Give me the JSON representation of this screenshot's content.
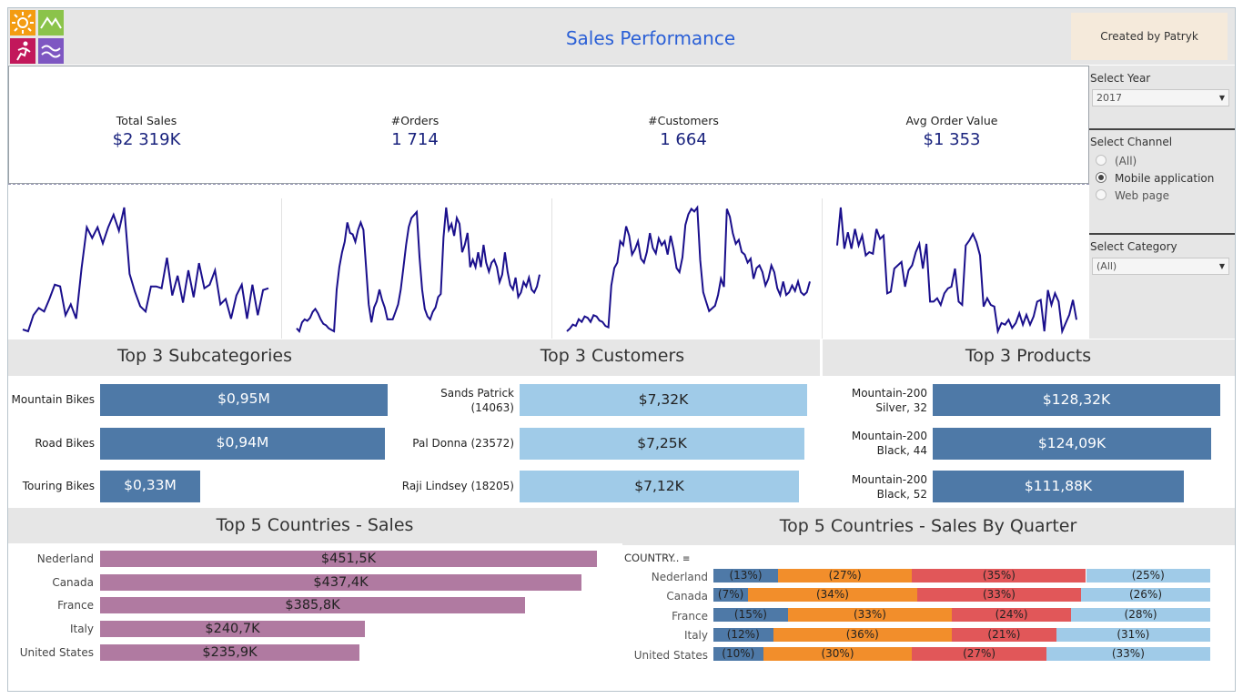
{
  "header": {
    "title": "Sales Performance",
    "created_by": "Created by Patryk Kazmierak",
    "logo_colors": [
      "#f39c12",
      "#8bc34a",
      "#c2185b",
      "#7e57c2"
    ]
  },
  "kpis": [
    {
      "label": "Total Sales",
      "value": "$2 319K"
    },
    {
      "label": "#Orders",
      "value": "1 714"
    },
    {
      "label": "#Customers",
      "value": "1 664"
    },
    {
      "label": "Avg Order Value",
      "value": "$1 353"
    }
  ],
  "filters": {
    "year": {
      "label": "Select Year",
      "value": "2017"
    },
    "channel": {
      "label": "Select Channel",
      "options": [
        "(All)",
        "Mobile application",
        "Web page"
      ],
      "selected": "Mobile application"
    },
    "category": {
      "label": "Select Category",
      "value": "(All)"
    }
  },
  "sections": {
    "subcategories": "Top 3 Subcategories",
    "customers": "Top 3 Customers",
    "products": "Top 3 Products",
    "countries_sales": "Top 5 Countries - Sales",
    "countries_quarter": "Top 5 Countries - Sales By Quarter",
    "country_column_header": "COUNTRY.."
  },
  "colors": {
    "blue": "#4e79a7",
    "lightblue": "#a0cbe8",
    "purple": "#b07aa1",
    "orange": "#f28e2b",
    "red": "#e15759",
    "line": "#1a0f8c"
  },
  "chart_data": [
    {
      "type": "line",
      "title": "Total Sales trend",
      "values": [
        2,
        1,
        10,
        14,
        12,
        19,
        27,
        26,
        10,
        16,
        8,
        36,
        59,
        53,
        59,
        50,
        59,
        66,
        57,
        70,
        33,
        23,
        15,
        12,
        26,
        26,
        25,
        42,
        21,
        32,
        17,
        35,
        20,
        39,
        25,
        27,
        35,
        16,
        19,
        8,
        21,
        27,
        8,
        27,
        10,
        24,
        25
      ]
    },
    {
      "type": "line",
      "title": "#Orders trend",
      "values": [
        4,
        2,
        8,
        10,
        9,
        11,
        15,
        17,
        14,
        10,
        7,
        6,
        4,
        3,
        2,
        30,
        45,
        55,
        62,
        75,
        68,
        67,
        62,
        70,
        75,
        70,
        45,
        20,
        8,
        18,
        22,
        30,
        23,
        18,
        10,
        10,
        10,
        15,
        20,
        30,
        45,
        60,
        72,
        78,
        80,
        82,
        52,
        30,
        17,
        12,
        10,
        15,
        18,
        25,
        27,
        65,
        85,
        70,
        74,
        66,
        78,
        74,
        55,
        60,
        68,
        45,
        50,
        45,
        55,
        45,
        60,
        48,
        42,
        48,
        50,
        45,
        35,
        40,
        55,
        42,
        33,
        30,
        38,
        25,
        28,
        35,
        32,
        38,
        30,
        28,
        32,
        40
      ]
    },
    {
      "type": "line",
      "title": "#Customers trend",
      "values": [
        1,
        3,
        6,
        5,
        10,
        8,
        12,
        11,
        8,
        13,
        12,
        9,
        8,
        5,
        4,
        35,
        48,
        52,
        68,
        65,
        79,
        72,
        58,
        62,
        68,
        55,
        52,
        60,
        74,
        63,
        59,
        70,
        65,
        68,
        58,
        72,
        62,
        48,
        45,
        56,
        80,
        88,
        92,
        90,
        93,
        54,
        30,
        23,
        16,
        18,
        20,
        28,
        40,
        34,
        92,
        86,
        74,
        66,
        69,
        60,
        58,
        52,
        55,
        40,
        48,
        50,
        45,
        35,
        40,
        50,
        45,
        33,
        28,
        38,
        28,
        30,
        35,
        31,
        38,
        30,
        28,
        30,
        38
      ]
    },
    {
      "type": "line",
      "title": "Avg Order Value trend",
      "values": [
        72,
        95,
        70,
        80,
        70,
        82,
        72,
        78,
        66,
        68,
        67,
        82,
        76,
        78,
        43,
        44,
        58,
        60,
        62,
        47,
        57,
        60,
        68,
        73,
        58,
        73,
        38,
        38,
        40,
        36,
        43,
        46,
        47,
        58,
        38,
        36,
        72,
        75,
        79,
        74,
        66,
        35,
        40,
        36,
        35,
        20,
        25,
        24,
        27,
        22,
        25,
        31,
        24,
        30,
        24,
        29,
        38,
        39,
        20,
        45,
        36,
        43,
        38,
        20,
        25,
        30,
        39,
        27
      ]
    },
    {
      "type": "bar",
      "title": "Top 3 Subcategories",
      "categories": [
        "Mountain Bikes",
        "Road Bikes",
        "Touring Bikes"
      ],
      "values": [
        0.95,
        0.94,
        0.33
      ],
      "unit": "$M",
      "labels": [
        "$0,95M",
        "$0,94M",
        "$0,33M"
      ],
      "max": 0.95
    },
    {
      "type": "bar",
      "title": "Top 3 Customers",
      "categories": [
        [
          "Sands Patrick",
          "(14063)"
        ],
        [
          "Pal Donna (23572)"
        ],
        [
          "Raji Lindsey (18205)"
        ]
      ],
      "values": [
        7.32,
        7.25,
        7.12
      ],
      "unit": "$K",
      "labels": [
        "$7,32K",
        "$7,25K",
        "$7,12K"
      ],
      "max": 7.32
    },
    {
      "type": "bar",
      "title": "Top 3 Products",
      "categories": [
        [
          "Mountain-200",
          "Silver, 32"
        ],
        [
          "Mountain-200",
          "Black, 44"
        ],
        [
          "Mountain-200",
          "Black, 52"
        ]
      ],
      "values": [
        128.32,
        124.09,
        111.88
      ],
      "unit": "$K",
      "labels": [
        "$128,32K",
        "$124,09K",
        "$111,88K"
      ],
      "max": 128.32
    },
    {
      "type": "bar",
      "title": "Top 5 Countries - Sales",
      "categories": [
        "Nederland",
        "Canada",
        "France",
        "Italy",
        "United States"
      ],
      "values": [
        451.5,
        437.4,
        385.8,
        240.7,
        235.9
      ],
      "unit": "$K",
      "labels": [
        "$451,5K",
        "$437,4K",
        "$385,8K",
        "$240,7K",
        "$235,9K"
      ],
      "max": 451.5
    },
    {
      "type": "bar",
      "title": "Top 5 Countries - Sales By Quarter",
      "stacked": true,
      "categories": [
        "Nederland",
        "Canada",
        "France",
        "Italy",
        "United States"
      ],
      "series": [
        {
          "values": [
            13,
            7,
            15,
            12,
            10
          ]
        },
        {
          "values": [
            27,
            34,
            33,
            36,
            30
          ]
        },
        {
          "values": [
            35,
            33,
            24,
            21,
            27
          ]
        },
        {
          "values": [
            25,
            26,
            28,
            31,
            33
          ]
        }
      ],
      "labels": [
        [
          "(13%)",
          "(27%)",
          "(35%)",
          "(25%)"
        ],
        [
          "(7%)",
          "(34%)",
          "(33%)",
          "(26%)"
        ],
        [
          "(15%)",
          "(33%)",
          "(24%)",
          "(28%)"
        ],
        [
          "(12%)",
          "(36%)",
          "(21%)",
          "(31%)"
        ],
        [
          "(10%)",
          "(30%)",
          "(27%)",
          "(33%)"
        ]
      ]
    }
  ]
}
